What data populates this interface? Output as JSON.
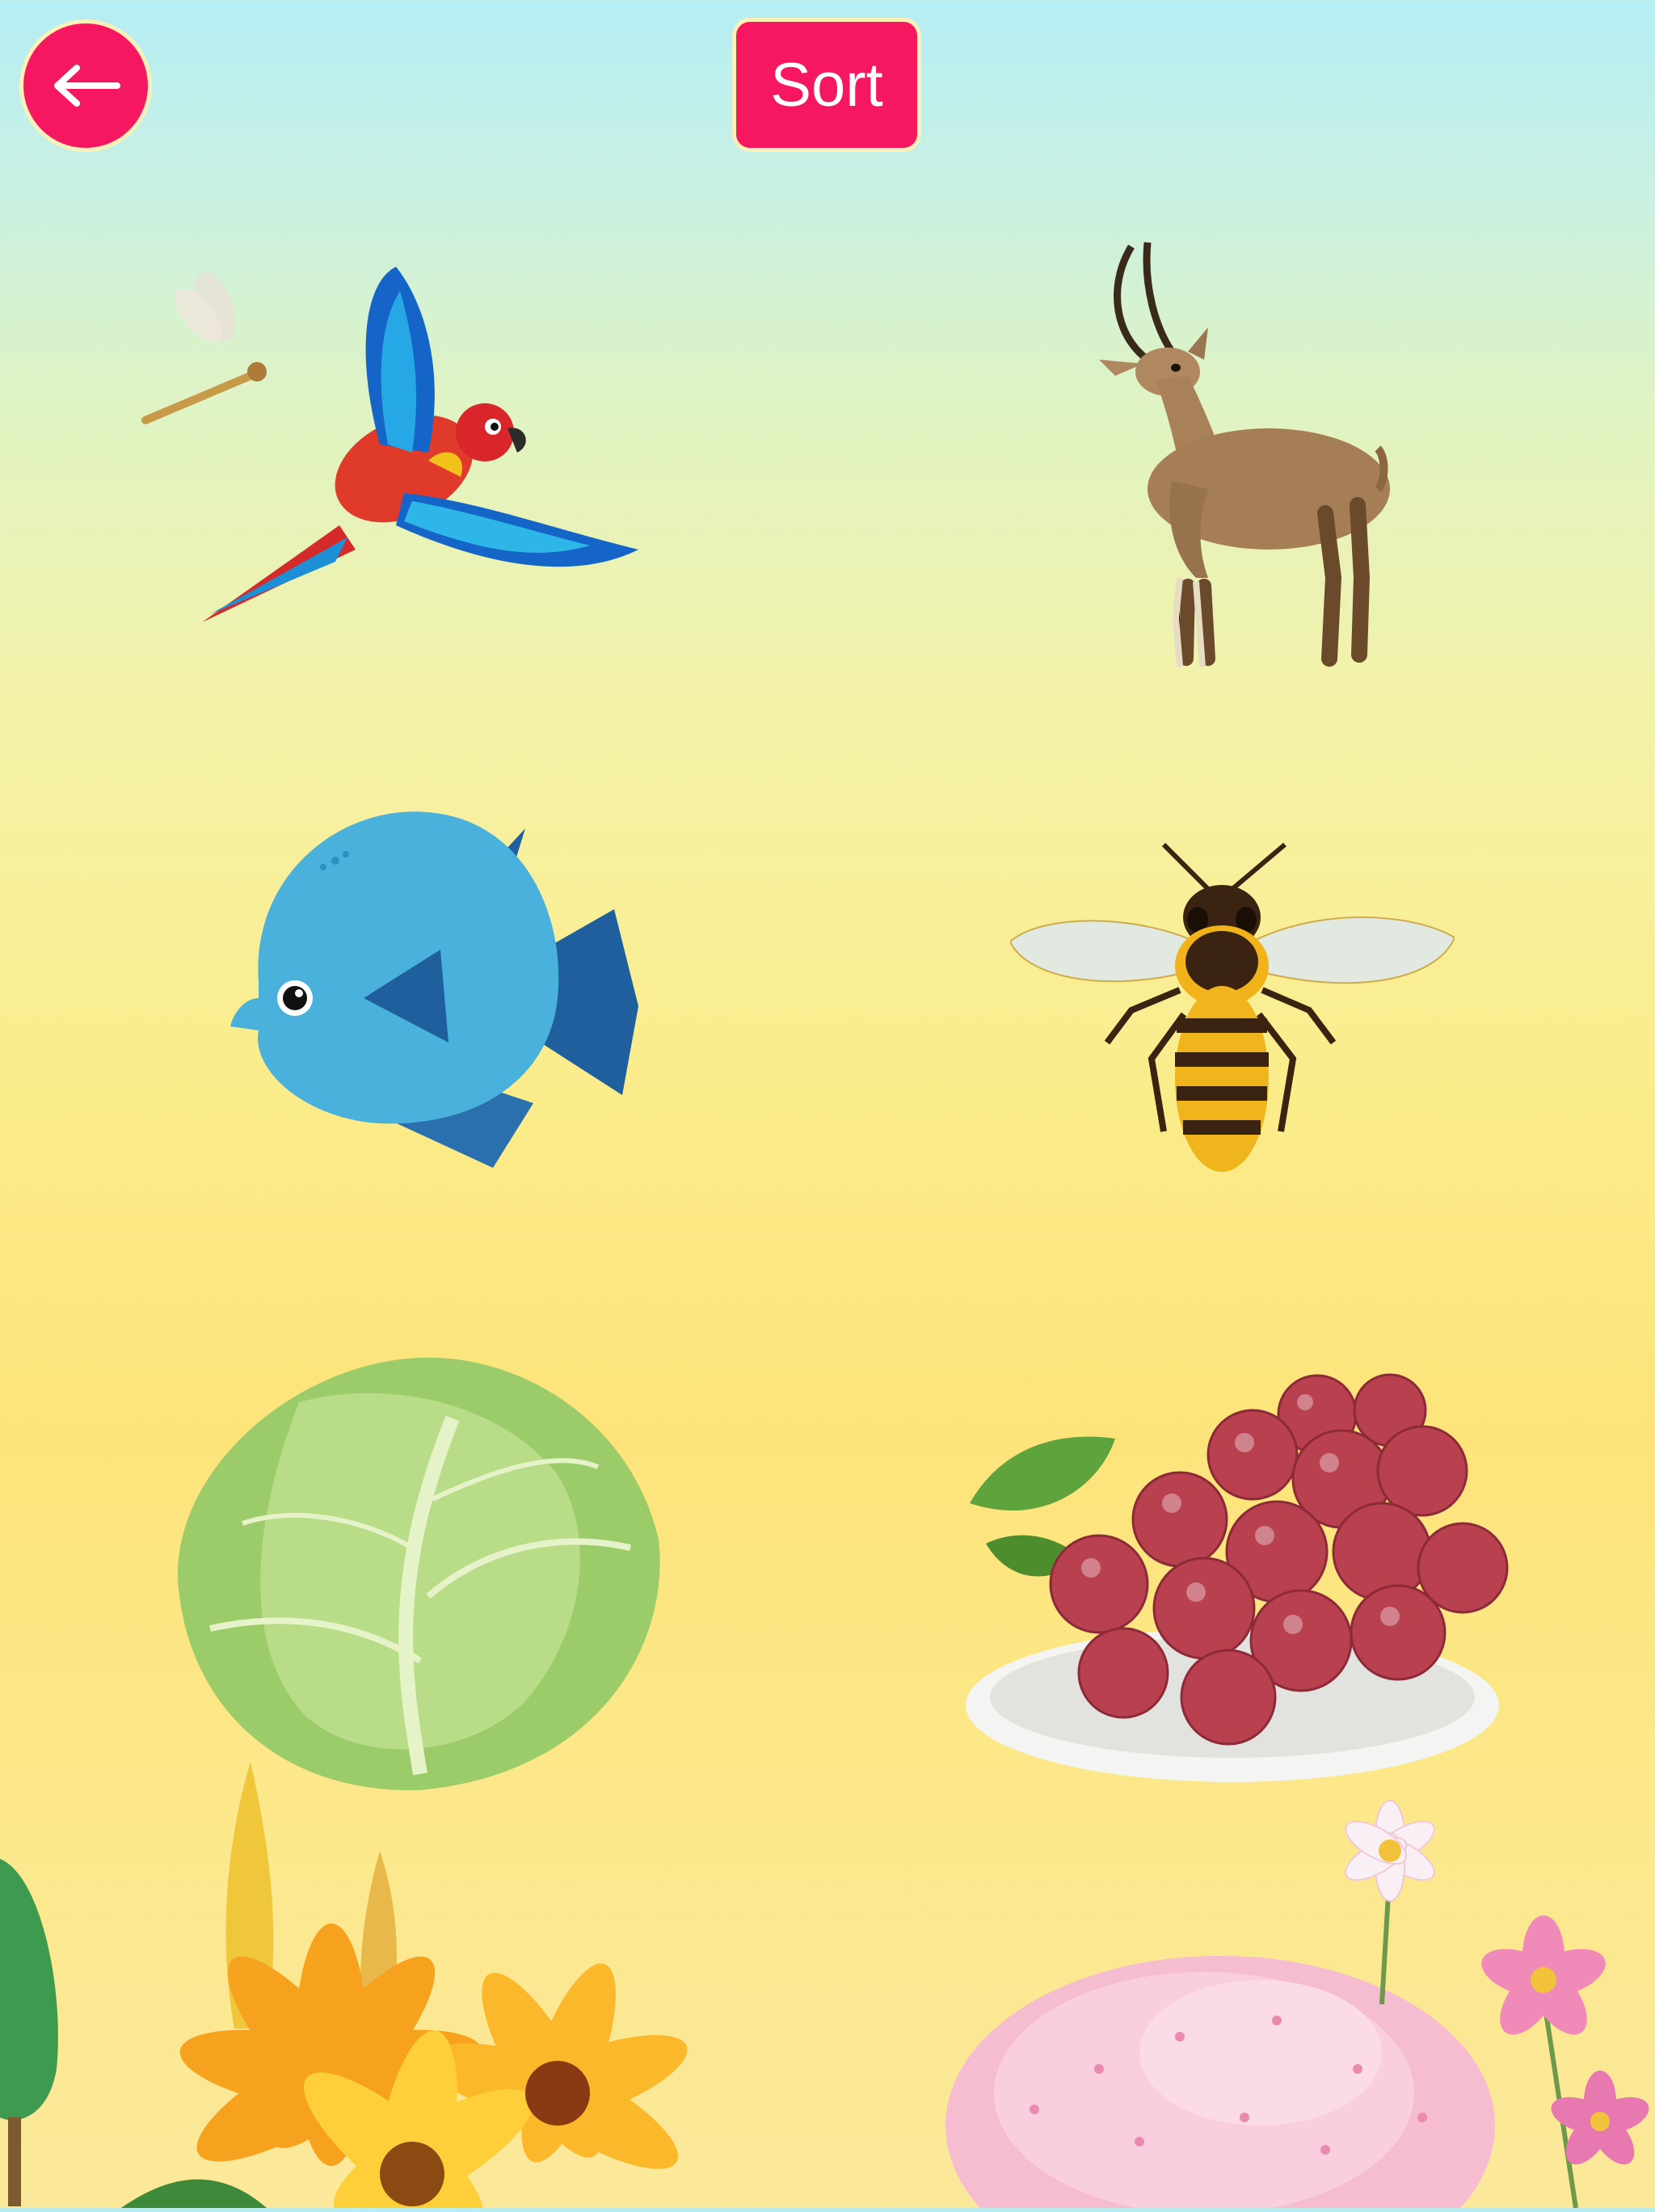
{
  "header": {
    "back_icon": "arrow-left-icon",
    "sort_label": "Sort",
    "accent_color": "#f5175f"
  },
  "items": [
    {
      "name": "parrot",
      "icon": "parrot-icon"
    },
    {
      "name": "antelope",
      "icon": "antelope-icon"
    },
    {
      "name": "fish",
      "icon": "fish-icon"
    },
    {
      "name": "bee",
      "icon": "bee-icon"
    },
    {
      "name": "cabbage",
      "icon": "cabbage-icon"
    },
    {
      "name": "grapes",
      "icon": "grapes-icon"
    }
  ]
}
